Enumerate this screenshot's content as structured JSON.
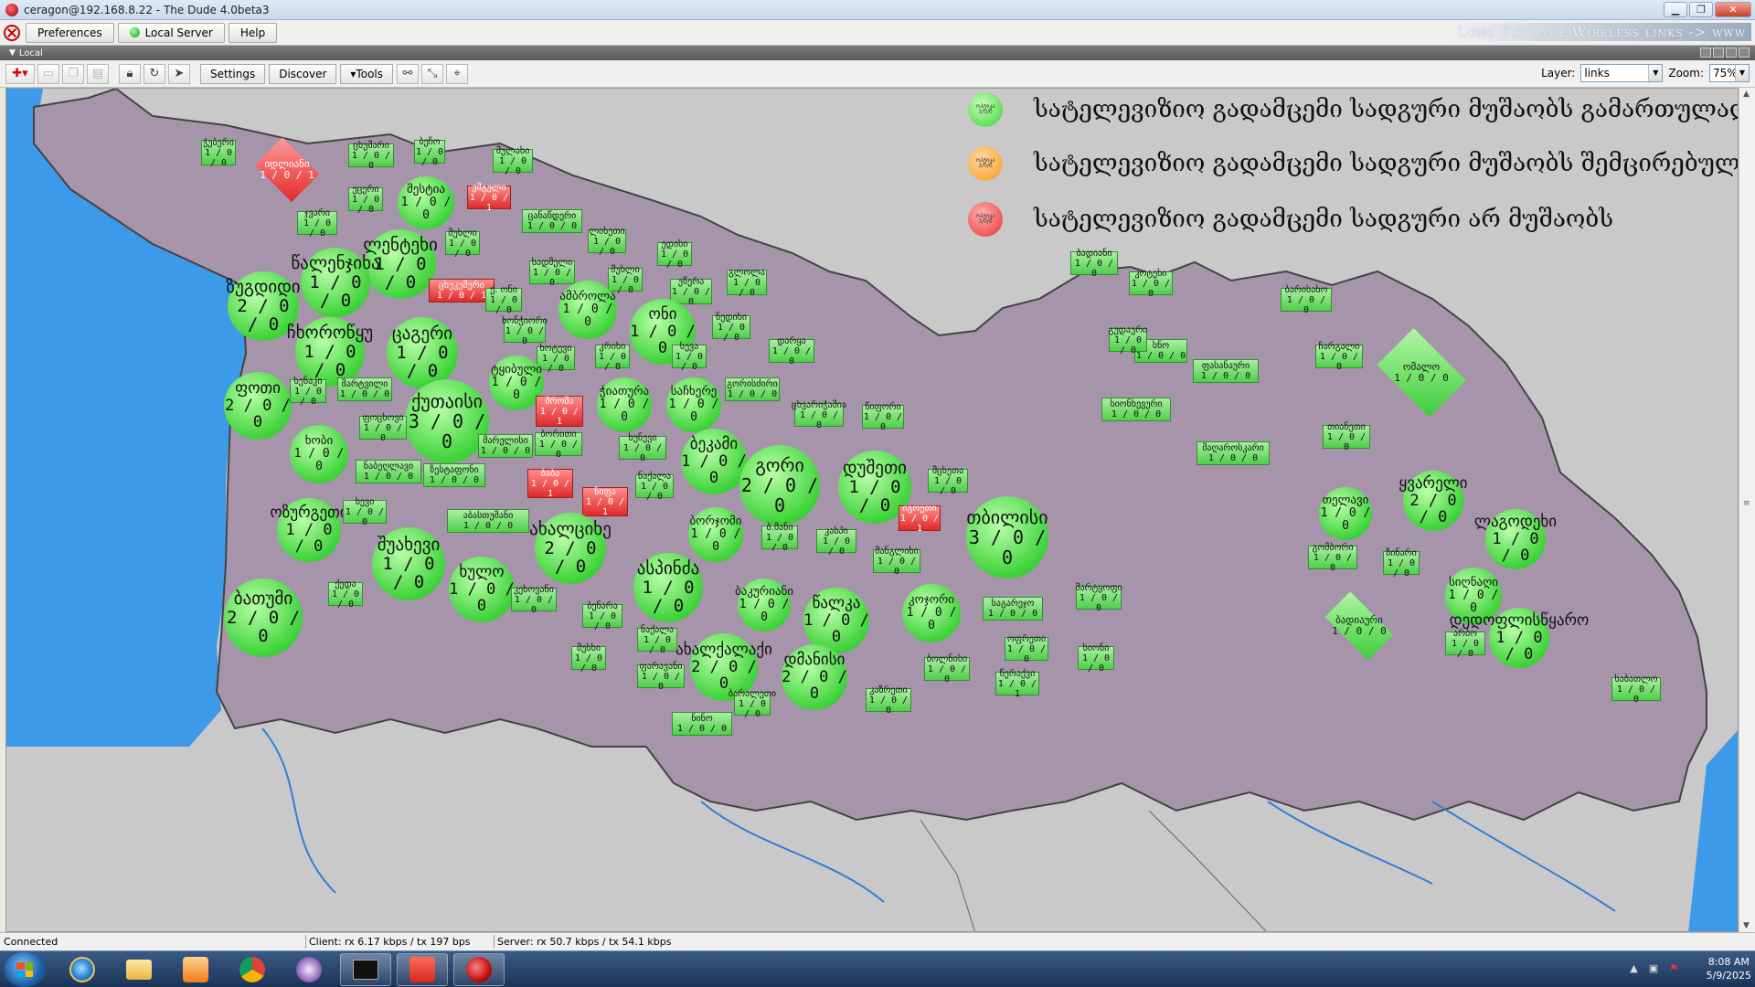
{
  "window": {
    "title": "ceragon@192.168.8.22 - The Dude 4.0beta3",
    "minimize": "▁",
    "restore": "❐",
    "close": "✕"
  },
  "menubar": {
    "preferences": "Preferences",
    "local_server": "Local Server",
    "help": "Help",
    "brand": "Long Distance Wireless links -> www"
  },
  "pane": {
    "title": "Local"
  },
  "toolbar": {
    "settings": "Settings",
    "discover": "Discover",
    "tools": "▾Tools",
    "layer_label": "Layer:",
    "layer_value": "links",
    "zoom_label": "Zoom:",
    "zoom_value": "75%"
  },
  "colors": {
    "up": "#3fd33a",
    "partial": "#f59a1e",
    "down": "#e02a2a",
    "sea": "#3d9ae8",
    "country": "#a694ab"
  },
  "legend": [
    {
      "mini": "ოპტიკა",
      "mini2": "3/0/0",
      "color": "green",
      "text": "სატელევიზიო გადამცემი სადგური მუშაობს გამართულად"
    },
    {
      "mini": "ოპტიკა",
      "mini2": "3/0/0",
      "color": "orange",
      "text": "სატელევიზიო გადამცემი სადგური მუშაობს შემცირებული სიმძლავრით"
    },
    {
      "mini": "ოპტიკა",
      "mini2": "3/0/0",
      "color": "red",
      "text": "სატელევიზიო გადამცემი სადგური არ მუშაობს"
    }
  ],
  "nodes": [
    {
      "name": "ჭუბერი",
      "status": "1 / 0 / 0",
      "shape": "rect",
      "state": "up"
    },
    {
      "name": "იდლიანი",
      "status": "1 / 0 / 1",
      "shape": "diamond",
      "state": "down"
    },
    {
      "name": "ცხუმარი",
      "status": "1 / 0 / 0",
      "shape": "rect",
      "state": "up"
    },
    {
      "name": "ბეჩო",
      "status": "1 / 0 / 0",
      "shape": "rect",
      "state": "up"
    },
    {
      "name": "მულახი",
      "status": "1 / 0 / 0",
      "shape": "rect",
      "state": "up"
    },
    {
      "name": "ეცერი",
      "status": "1 / 0 / 0",
      "shape": "rect",
      "state": "up"
    },
    {
      "name": "მესტია",
      "status": "1 / 0 / 0",
      "shape": "circle",
      "state": "up"
    },
    {
      "name": "უშგული",
      "status": "1 / 0 / 1",
      "shape": "rect",
      "state": "down"
    },
    {
      "name": "ჯვარი",
      "status": "1 / 0 / 0",
      "shape": "rect",
      "state": "up"
    },
    {
      "name": "ცანაწდერი",
      "status": "1 / 0 / 0",
      "shape": "rect",
      "state": "up"
    },
    {
      "name": "ლენტეხი",
      "status": "1 / 0 / 0",
      "shape": "circle",
      "state": "up"
    },
    {
      "name": "მუხლი",
      "status": "1 / 0 / 0",
      "shape": "rect",
      "state": "up"
    },
    {
      "name": "ზუგდიდი",
      "status": "2 / 0 / 0",
      "shape": "circle",
      "state": "up"
    },
    {
      "name": "წალენჯიხა",
      "status": "1 / 0 / 0",
      "shape": "circle",
      "state": "up"
    },
    {
      "name": "ცხუკუშერი",
      "status": "1 / 0 / 1",
      "shape": "rect",
      "state": "down"
    },
    {
      "name": "ლიხეთი",
      "status": "1 / 0 / 0",
      "shape": "rect",
      "state": "up"
    },
    {
      "name": "ედისი",
      "status": "1 / 0 / 0",
      "shape": "rect",
      "state": "up"
    },
    {
      "name": "სადმელი",
      "status": "1 / 0 / 0",
      "shape": "rect",
      "state": "up"
    },
    {
      "name": "მუხლი",
      "status": "1 / 0 / 0",
      "shape": "rect",
      "state": "up"
    },
    {
      "name": "უწერა",
      "status": "1 / 0 / 0",
      "shape": "rect",
      "state": "up"
    },
    {
      "name": "გლოლა",
      "status": "1 / 0 / 0",
      "shape": "rect",
      "state": "up"
    },
    {
      "name": "ქ. ონი",
      "status": "1 / 0 / 0",
      "shape": "rect",
      "state": "up"
    },
    {
      "name": "ამბროლა",
      "status": "1 / 0 / 0",
      "shape": "circle",
      "state": "up"
    },
    {
      "name": "ჩხოროწყუ",
      "status": "1 / 0 / 0",
      "shape": "circle",
      "state": "up"
    },
    {
      "name": "ცაგერი",
      "status": "1 / 0 / 0",
      "shape": "circle",
      "state": "up"
    },
    {
      "name": "ხონჭიორი",
      "status": "1 / 0 / 0",
      "shape": "rect",
      "state": "up"
    },
    {
      "name": "ონი",
      "status": "1 / 0 / 0",
      "shape": "circle",
      "state": "up"
    },
    {
      "name": "ნედისი",
      "status": "1 / 0 / 0",
      "shape": "rect",
      "state": "up"
    },
    {
      "name": "ხოტევი",
      "status": "1 / 0 / 0",
      "shape": "rect",
      "state": "up"
    },
    {
      "name": "კრიხი",
      "status": "1 / 0 / 0",
      "shape": "rect",
      "state": "up"
    },
    {
      "name": "სევა",
      "status": "1 / 0 / 0",
      "shape": "rect",
      "state": "up"
    },
    {
      "name": "დარყა",
      "status": "1 / 0 / 0",
      "shape": "rect",
      "state": "up"
    },
    {
      "name": "ფოთი",
      "status": "2 / 0 / 0",
      "shape": "circle",
      "state": "up"
    },
    {
      "name": "სენაკი",
      "status": "1 / 0 / 0",
      "shape": "rect",
      "state": "up"
    },
    {
      "name": "მარტვილი",
      "status": "1 / 0 / 0",
      "shape": "rect",
      "state": "up"
    },
    {
      "name": "ქუთაისი",
      "status": "3 / 0 / 0",
      "shape": "circle",
      "state": "up"
    },
    {
      "name": "ტყიბული",
      "status": "1 / 0 / 0",
      "shape": "circle",
      "state": "up"
    },
    {
      "name": "შროშა",
      "status": "1 / 0 / 1",
      "shape": "rect",
      "state": "down"
    },
    {
      "name": "ჭიათურა",
      "status": "1 / 0 / 0",
      "shape": "circle",
      "state": "up"
    },
    {
      "name": "საჩხერე",
      "status": "1 / 0 / 0",
      "shape": "circle",
      "state": "up"
    },
    {
      "name": "გორისძირი",
      "status": "1 / 0 / 0",
      "shape": "rect",
      "state": "up"
    },
    {
      "name": "ფოცხოვი",
      "status": "1 / 0 / 0",
      "shape": "rect",
      "state": "up"
    },
    {
      "name": "ხობი",
      "status": "1 / 0 / 0",
      "shape": "circle",
      "state": "up"
    },
    {
      "name": "ბორითი",
      "status": "1 / 0 / 0",
      "shape": "rect",
      "state": "up"
    },
    {
      "name": "მარელისი",
      "status": "1 / 0 / 0",
      "shape": "rect",
      "state": "up"
    },
    {
      "name": "ხუნევი",
      "status": "1 / 0 / 0",
      "shape": "rect",
      "state": "up"
    },
    {
      "name": "ბეკამი",
      "status": "1 / 0 / 0",
      "shape": "circle",
      "state": "up"
    },
    {
      "name": "ნაბეღლავი",
      "status": "1 / 0 / 0",
      "shape": "rect",
      "state": "up"
    },
    {
      "name": "ზესტაფონი",
      "status": "1 / 0 / 0",
      "shape": "rect",
      "state": "up"
    },
    {
      "name": "ბაბა",
      "status": "1 / 0 / 1",
      "shape": "rect",
      "state": "down"
    },
    {
      "name": "ნიფა",
      "status": "1 / 0 / 1",
      "shape": "rect",
      "state": "down"
    },
    {
      "name": "ნაქალა",
      "status": "1 / 0 / 0",
      "shape": "rect",
      "state": "up"
    },
    {
      "name": "გორი",
      "status": "2 / 0 / 0",
      "shape": "circle",
      "state": "up"
    },
    {
      "name": "ოზურგეთი",
      "status": "1 / 0 / 0",
      "shape": "circle",
      "state": "up"
    },
    {
      "name": "ხევი",
      "status": "1 / 0 / 0",
      "shape": "rect",
      "state": "up"
    },
    {
      "name": "აბასთუმანი",
      "status": "1 / 0 / 0",
      "shape": "rect",
      "state": "up"
    },
    {
      "name": "შუახევი",
      "status": "1 / 0 / 0",
      "shape": "circle",
      "state": "up"
    },
    {
      "name": "ახალციხე",
      "status": "2 / 0 / 0",
      "shape": "circle",
      "state": "up"
    },
    {
      "name": "ბორჯომი",
      "status": "1 / 0 / 0",
      "shape": "circle",
      "state": "up"
    },
    {
      "name": "ხულო",
      "status": "1 / 0 / 0",
      "shape": "circle",
      "state": "up"
    },
    {
      "name": "ასპინძა",
      "status": "1 / 0 / 0",
      "shape": "circle",
      "state": "up"
    },
    {
      "name": "ბაკურიანი",
      "status": "1 / 0 / 0",
      "shape": "circle",
      "state": "up"
    },
    {
      "name": "წალკა",
      "status": "1 / 0 / 0",
      "shape": "circle",
      "state": "up"
    },
    {
      "name": "ბათუმი",
      "status": "2 / 0 / 0",
      "shape": "circle",
      "state": "up"
    },
    {
      "name": "ქედა",
      "status": "1 / 0 / 0",
      "shape": "rect",
      "state": "up"
    },
    {
      "name": "კეხოვანი",
      "status": "1 / 0 / 0",
      "shape": "rect",
      "state": "up"
    },
    {
      "name": "ბენარა",
      "status": "1 / 0 / 0",
      "shape": "rect",
      "state": "up"
    },
    {
      "name": "ნაქალა",
      "status": "1 / 0 / 0",
      "shape": "rect",
      "state": "up"
    },
    {
      "name": "მუსხი",
      "status": "1 / 0 / 0",
      "shape": "rect",
      "state": "up"
    },
    {
      "name": "ახალქალაქი",
      "status": "2 / 0 / 0",
      "shape": "circle",
      "state": "up"
    },
    {
      "name": "დმანისი",
      "status": "2 / 0 / 0",
      "shape": "circle",
      "state": "up"
    },
    {
      "name": "ფარავანი",
      "status": "1 / 0 / 0",
      "shape": "rect",
      "state": "up"
    },
    {
      "name": "ნინო",
      "status": "1 / 0 / 0",
      "shape": "rect",
      "state": "up"
    },
    {
      "name": "ბარალეთი",
      "status": "1 / 0 / 0",
      "shape": "rect",
      "state": "up"
    },
    {
      "name": "კაზრეთი",
      "status": "1 / 0 / 0",
      "shape": "rect",
      "state": "up"
    },
    {
      "name": "კასპი",
      "status": "1 / 0 / 0",
      "shape": "rect",
      "state": "up"
    },
    {
      "name": "მანგლისი",
      "status": "1 / 0 / 0",
      "shape": "rect",
      "state": "up"
    },
    {
      "name": "ბ.მანი",
      "status": "1 / 0 / 0",
      "shape": "rect",
      "state": "up"
    },
    {
      "name": "ცხვარიჭამია",
      "status": "1 / 0 / 0",
      "shape": "rect",
      "state": "up"
    },
    {
      "name": "წიფორი",
      "status": "1 / 0 / 0",
      "shape": "rect",
      "state": "up"
    },
    {
      "name": "დუშეთი",
      "status": "1 / 0 / 0",
      "shape": "circle",
      "state": "up"
    },
    {
      "name": "იგოეთი",
      "status": "1 / 0 / 1",
      "shape": "rect",
      "state": "down"
    },
    {
      "name": "მცხეთა",
      "status": "1 / 0 / 0",
      "shape": "rect",
      "state": "up"
    },
    {
      "name": "თბილისი",
      "status": "3 / 0 / 0",
      "shape": "circle",
      "state": "up"
    },
    {
      "name": "კოჯორი",
      "status": "1 / 0 / 0",
      "shape": "circle",
      "state": "up"
    },
    {
      "name": "საგარეჯო",
      "status": "1 / 0 / 0",
      "shape": "rect",
      "state": "up"
    },
    {
      "name": "ოფრეთი",
      "status": "1 / 0 / 0",
      "shape": "rect",
      "state": "up"
    },
    {
      "name": "ბოლნისი",
      "status": "1 / 0 / 0",
      "shape": "rect",
      "state": "up"
    },
    {
      "name": "წერაქვი",
      "status": "1 / 0 / 1",
      "shape": "rect",
      "state": "up"
    },
    {
      "name": "სიონი",
      "status": "1 / 0 / 0",
      "shape": "rect",
      "state": "up"
    },
    {
      "name": "მარტყოფი",
      "status": "1 / 0 / 0",
      "shape": "rect",
      "state": "up"
    },
    {
      "name": "ბადიანი",
      "status": "1 / 0 / 0",
      "shape": "rect",
      "state": "up"
    },
    {
      "name": "კოტეხი",
      "status": "1 / 0 / 0",
      "shape": "rect",
      "state": "up"
    },
    {
      "name": "სნო",
      "status": "1 / 0 / 0",
      "shape": "rect",
      "state": "up"
    },
    {
      "name": "გუდაური",
      "status": "1 / 0 / 0",
      "shape": "rect",
      "state": "up"
    },
    {
      "name": "ფასანაური",
      "status": "1 / 0 / 0",
      "shape": "rect",
      "state": "up"
    },
    {
      "name": "ბარისახო",
      "status": "1 / 0 / 0",
      "shape": "rect",
      "state": "up"
    },
    {
      "name": "ჩარგალი",
      "status": "1 / 0 / 0",
      "shape": "rect",
      "state": "up"
    },
    {
      "name": "ომალო",
      "status": "1 / 0 / 0",
      "shape": "diamond",
      "state": "up"
    },
    {
      "name": "სიონხევური",
      "status": "1 / 0 / 0",
      "shape": "rect",
      "state": "up"
    },
    {
      "name": "მაღაროსკარი",
      "status": "1 / 0 / 0",
      "shape": "rect",
      "state": "up"
    },
    {
      "name": "თიანეთი",
      "status": "1 / 0 / 0",
      "shape": "rect",
      "state": "up"
    },
    {
      "name": "თელავი",
      "status": "1 / 0 / 0",
      "shape": "circle",
      "state": "up"
    },
    {
      "name": "ყვარელი",
      "status": "2 / 0 / 0",
      "shape": "circle",
      "state": "up"
    },
    {
      "name": "ლაგოდეხი",
      "status": "1 / 0 / 0",
      "shape": "circle",
      "state": "up"
    },
    {
      "name": "გომბორი",
      "status": "1 / 0 / 0",
      "shape": "rect",
      "state": "up"
    },
    {
      "name": "ზინარი",
      "status": "1 / 0 / 0",
      "shape": "rect",
      "state": "up"
    },
    {
      "name": "სიღნაღი",
      "status": "1 / 0 / 0",
      "shape": "circle",
      "state": "up"
    },
    {
      "name": "ბადიაური",
      "status": "1 / 0 / 0",
      "shape": "diamond",
      "state": "up"
    },
    {
      "name": "არბო",
      "status": "1 / 0 / 0",
      "shape": "rect",
      "state": "up"
    },
    {
      "name": "დედოფლისწყარო",
      "status": "1 / 0 / 0",
      "shape": "circle",
      "state": "up"
    },
    {
      "name": "საბათლო",
      "status": "1 / 0 / 0",
      "shape": "rect",
      "state": "up"
    }
  ],
  "status": {
    "connection": "Connected",
    "client": "Client: rx 6.17 kbps / tx 197 bps",
    "server": "Server: rx 50.7 kbps / tx 54.1 kbps"
  },
  "taskbar": {
    "apps": [
      "internet-explorer",
      "file-explorer",
      "media-player",
      "chrome",
      "the-dude-agent",
      "command-prompt",
      "anydesk",
      "the-dude"
    ],
    "time": "8:08 AM",
    "date": "5/9/2025"
  }
}
